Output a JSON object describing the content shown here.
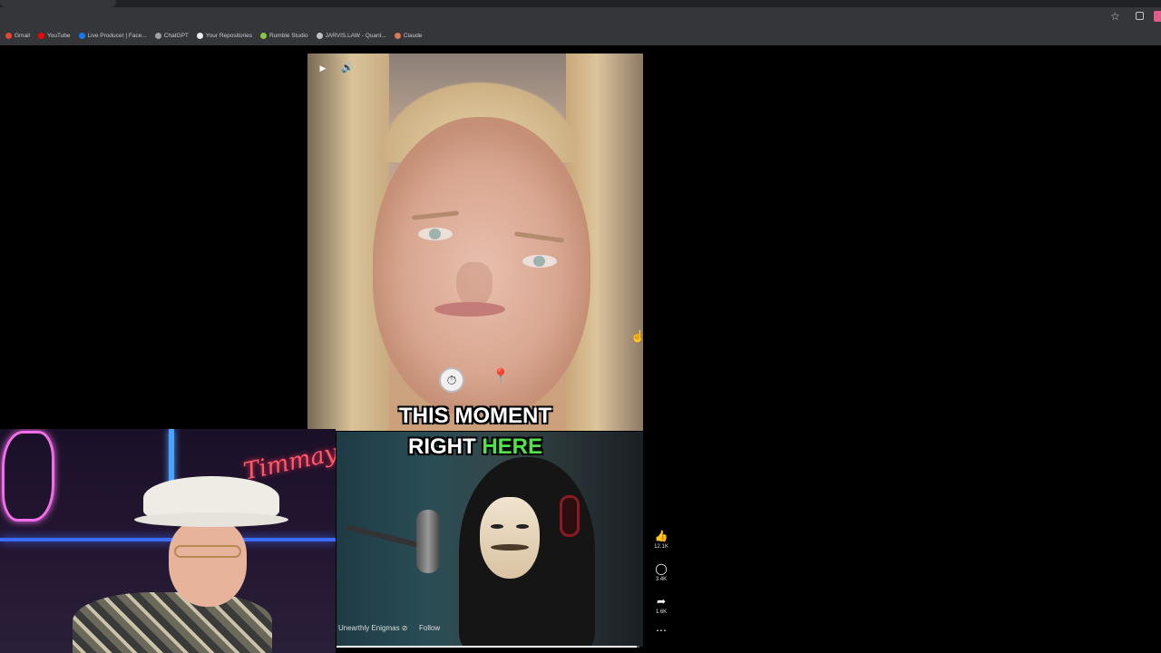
{
  "browser": {
    "bookmarks": [
      {
        "label": "Gmail",
        "color": "#ea4335"
      },
      {
        "label": "YouTube",
        "color": "#ff0000"
      },
      {
        "label": "Live Producer | Face...",
        "color": "#1877f2"
      },
      {
        "label": "ChatGPT",
        "color": "#9aa0a6"
      },
      {
        "label": "Your Repositories",
        "color": "#e8eaed"
      },
      {
        "label": "Rumble Studio",
        "color": "#85c742"
      },
      {
        "label": "JARVIS.LAW - Quant...",
        "color": "#bdc1c6"
      },
      {
        "label": "Claude",
        "color": "#d97757"
      }
    ]
  },
  "video": {
    "caption_line1": "THIS MOMENT",
    "caption_line2_white": "RIGHT",
    "caption_line2_green": "HERE",
    "stopwatch": "⏱",
    "pin": "📍",
    "channel": "Unearthly Enigmas ⊘",
    "follow": "Follow",
    "progress": 0.99
  },
  "actions": {
    "like_count": "12.1K",
    "comment_count": "3.4K",
    "share_count": "1.6K"
  },
  "webcam": {
    "neon_sign": "Timmay"
  },
  "colors": {
    "caption_highlight": "#53e24a"
  }
}
